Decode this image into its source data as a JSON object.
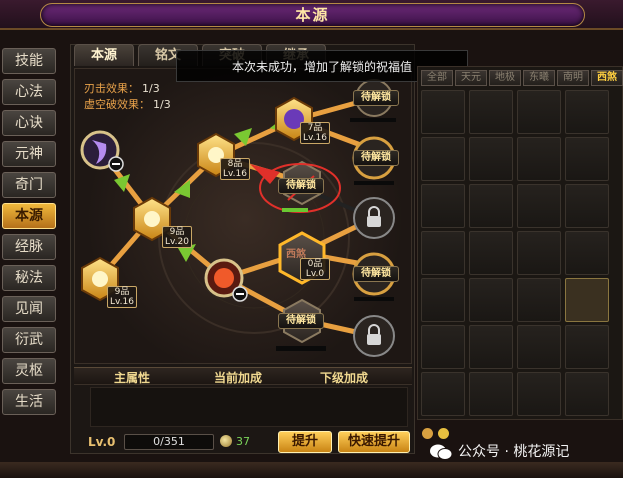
{
  "title": "本源",
  "left_menu": [
    "技能",
    "心法",
    "心诀",
    "元神",
    "奇门",
    "本源",
    "经脉",
    "秘法",
    "见闻",
    "衍武",
    "灵枢",
    "生活"
  ],
  "left_menu_active": "本源",
  "tabs": [
    "本源",
    "铭文",
    "突破",
    "继承"
  ],
  "tabs_active": "本源",
  "tooltip": "本次未成功，增加了解锁的祝福值",
  "stats": {
    "blade_label": "刃击效果：",
    "blade_value": "1/3",
    "void_label": "虚空破效果：",
    "void_value": "1/3"
  },
  "nodes": {
    "n1": {
      "line1": "9品",
      "line2": "Lv.16"
    },
    "n2": {
      "line1": "9品",
      "line2": "Lv.20"
    },
    "n3": {
      "line1": "8品",
      "line2": "Lv.16"
    },
    "n4": {
      "line1": "7品",
      "line2": "Lv.16"
    },
    "n5": {
      "line1": "0品",
      "line2": "Lv.0"
    },
    "n5_badge": "西煞"
  },
  "lock_label": "待解锁",
  "attr_table": {
    "col1": "主属性",
    "col2": "当前加成",
    "col3": "下级加成"
  },
  "bottom": {
    "level": "Lv.0",
    "exp": "0/351",
    "gem_count": "37",
    "upgrade": "提升",
    "quick_upgrade": "快速提升"
  },
  "filters": [
    "全部",
    "天元",
    "地极",
    "东曦",
    "南明",
    "西煞"
  ],
  "filters_active": "西煞",
  "watermark": "公众号 · 桃花源记",
  "colors": {
    "accent": "#f0b83c",
    "path_green": "#7ac832",
    "path_orange": "#e8a040",
    "active_filter": "#ffcf40"
  }
}
